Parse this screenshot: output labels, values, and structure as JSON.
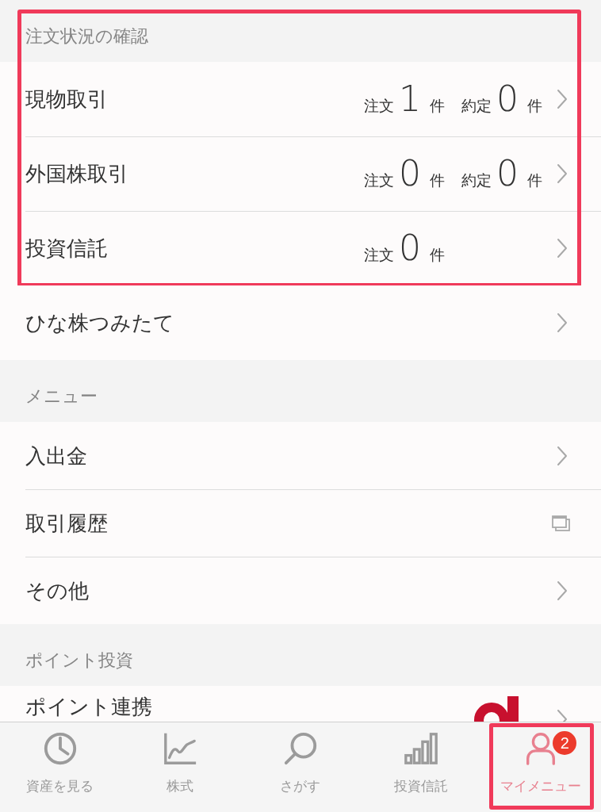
{
  "sections": [
    {
      "title": "注文状況の確認",
      "highlighted": true,
      "rows": [
        {
          "label": "現物取引",
          "kind": "link",
          "counts": [
            {
              "label": "注文",
              "value": "1",
              "unit": "件"
            },
            {
              "label": "約定",
              "value": "0",
              "unit": "件"
            }
          ]
        },
        {
          "label": "外国株取引",
          "kind": "link",
          "counts": [
            {
              "label": "注文",
              "value": "0",
              "unit": "件"
            },
            {
              "label": "約定",
              "value": "0",
              "unit": "件"
            }
          ]
        },
        {
          "label": "投資信託",
          "kind": "link",
          "counts": [
            {
              "label": "注文",
              "value": "0",
              "unit": "件"
            }
          ]
        }
      ]
    },
    {
      "highlighted": false,
      "rows": [
        {
          "label": "ひな株つみたて",
          "kind": "link"
        }
      ]
    },
    {
      "title": "メニュー",
      "highlighted": false,
      "rows": [
        {
          "label": "入出金",
          "kind": "link"
        },
        {
          "label": "取引履歴",
          "kind": "external"
        },
        {
          "label": "その他",
          "kind": "link"
        }
      ]
    },
    {
      "title": "ポイント投資",
      "highlighted": false,
      "rows": [
        {
          "label": "ポイント連携",
          "kind": "logo_link"
        }
      ]
    }
  ],
  "tab_bar": {
    "tabs": [
      {
        "label": "資産を見る",
        "selected": false,
        "highlighted": false
      },
      {
        "label": "株式",
        "selected": false,
        "highlighted": false
      },
      {
        "label": "さがす",
        "selected": false,
        "highlighted": false
      },
      {
        "label": "投資信託",
        "selected": false,
        "highlighted": false
      },
      {
        "label": "マイメニュー",
        "selected": true,
        "highlighted": true,
        "badge": "2"
      }
    ]
  }
}
